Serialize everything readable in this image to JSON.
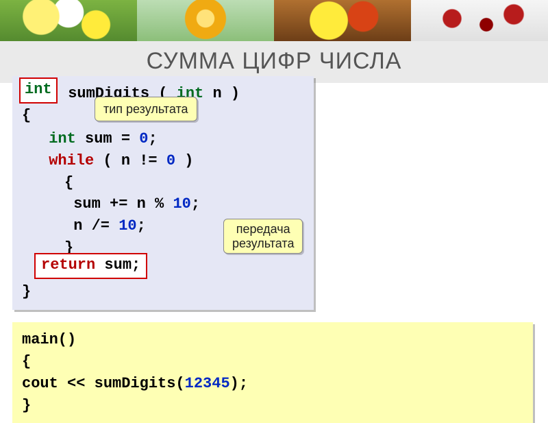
{
  "title": "СУММА ЦИФР ЧИСЛА",
  "int_tag": "int",
  "callouts": {
    "result_type": "тип результата",
    "result_pass": "передача\nрезультата"
  },
  "code": {
    "fn_name": "sumDigits",
    "kw_int": "int",
    "param_n": "n",
    "brace_open": "{",
    "brace_close": "}",
    "sum_decl_a": "sum",
    "eq": "=",
    "zero": "0",
    "semi": ";",
    "kw_while": "while",
    "cond_open": "(",
    "cond_n": "n",
    "ne": "!=",
    "cond_zero": "0",
    "cond_close": ")",
    "sum_pluseq": "sum +=",
    "n_mod": "n %",
    "ten": "10",
    "n_diveq": "n /=",
    "kw_return": "return",
    "return_val": "sum;"
  },
  "main": {
    "sig": "main()",
    "brace_open": "{",
    "cout": "cout << sumDigits(",
    "arg": "12345",
    "close": ");",
    "brace_close": "}"
  }
}
